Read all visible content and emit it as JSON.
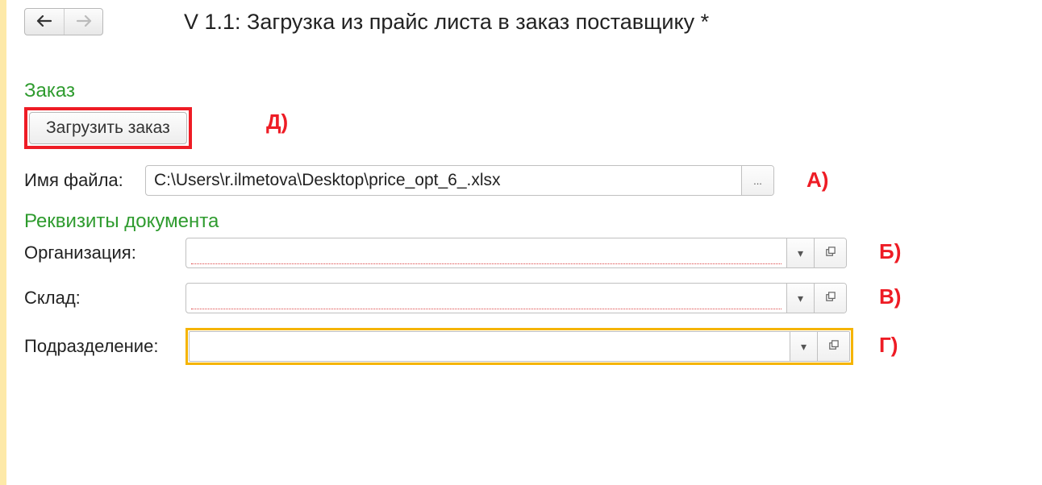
{
  "page_title": "V 1.1: Загрузка из прайс листа в заказ поставщику *",
  "sections": {
    "order_label": "Заказ",
    "requisites_label": "Реквизиты документа"
  },
  "buttons": {
    "load_order": "Загрузить заказ",
    "ellipsis": "...",
    "nav_back": "←",
    "nav_forward": "→"
  },
  "fields": {
    "filename_label": "Имя файла:",
    "filename_value": "C:\\Users\\r.ilmetova\\Desktop\\price_opt_6_.xlsx",
    "organization_label": "Организация:",
    "organization_value": "",
    "warehouse_label": "Склад:",
    "warehouse_value": "",
    "department_label": "Подразделение:",
    "department_value": ""
  },
  "annotations": {
    "a": "А)",
    "b": "Б)",
    "v": "В)",
    "g": "Г)",
    "d": "Д)"
  }
}
